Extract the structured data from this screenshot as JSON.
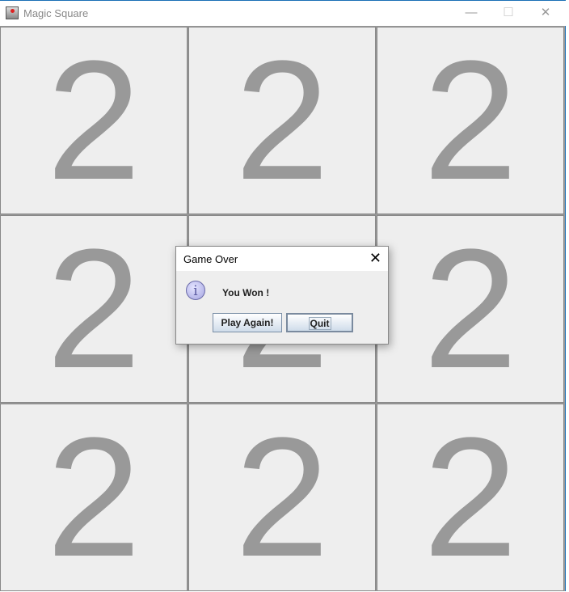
{
  "window": {
    "title": "Magic Square",
    "minimize": "—",
    "maximize": "☐",
    "close": "✕"
  },
  "grid": {
    "cells": [
      "2",
      "2",
      "2",
      "2",
      "2",
      "2",
      "2",
      "2",
      "2"
    ]
  },
  "dialog": {
    "title": "Game Over",
    "close": "✕",
    "icon": "i",
    "message": "You Won !",
    "buttons": {
      "play_again": "Play Again!",
      "quit": "Quit"
    }
  }
}
